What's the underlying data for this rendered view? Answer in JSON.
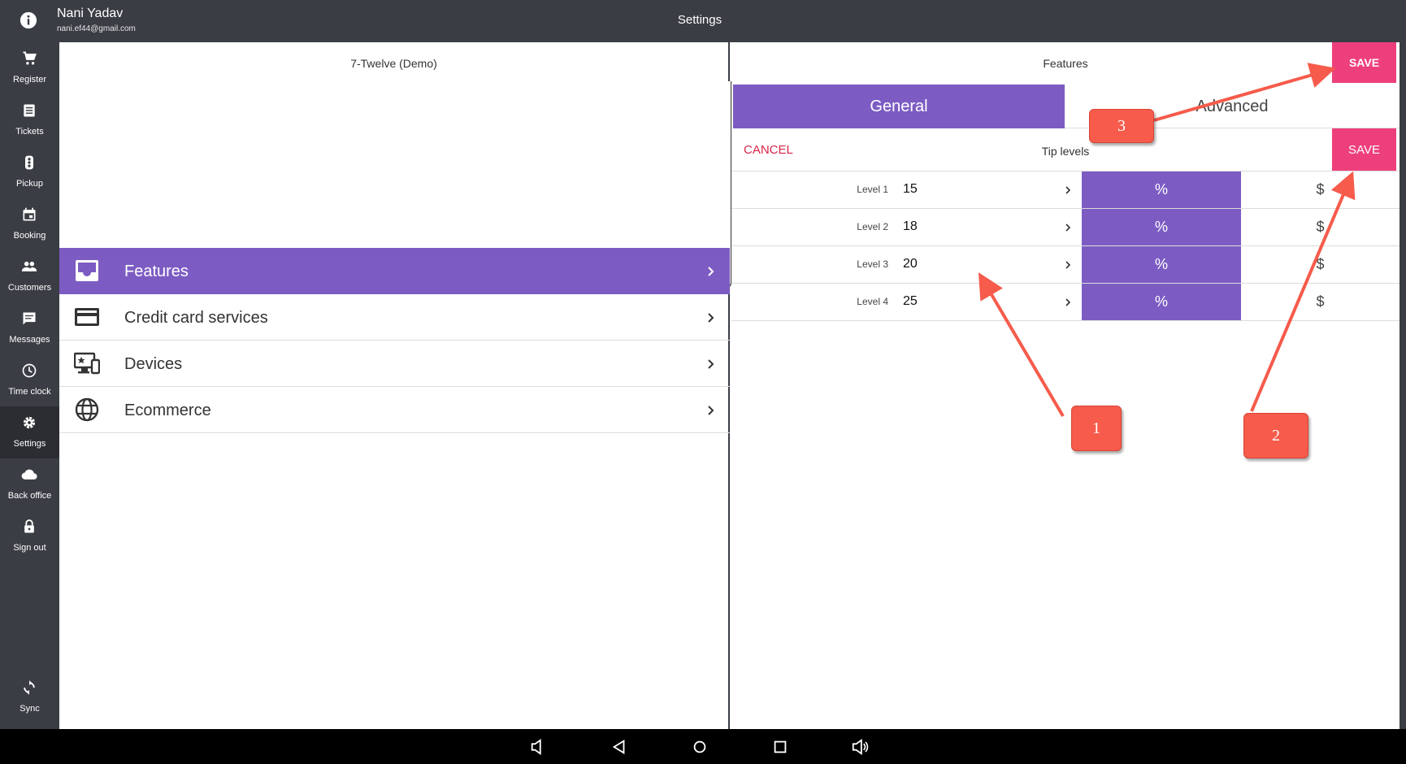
{
  "header": {
    "user_name": "Nani Yadav",
    "user_email": "nani.ef44@gmail.com",
    "page_title": "Settings"
  },
  "sidebar": {
    "items": [
      {
        "label": "Register",
        "icon": "cart-icon"
      },
      {
        "label": "Tickets",
        "icon": "tickets-icon"
      },
      {
        "label": "Pickup",
        "icon": "pickup-icon"
      },
      {
        "label": "Booking",
        "icon": "calendar-icon"
      },
      {
        "label": "Customers",
        "icon": "customers-icon"
      },
      {
        "label": "Messages",
        "icon": "message-icon"
      },
      {
        "label": "Time clock",
        "icon": "clock-icon"
      },
      {
        "label": "Settings",
        "icon": "gear-icon",
        "active": true
      },
      {
        "label": "Back office",
        "icon": "cloud-icon"
      },
      {
        "label": "Sign out",
        "icon": "lock-icon"
      }
    ],
    "sync_label": "Sync"
  },
  "left_panel": {
    "store_name": "7-Twelve (Demo)",
    "menu": [
      {
        "label": "Features",
        "icon": "features-icon",
        "active": true
      },
      {
        "label": "Credit card services",
        "icon": "credit-card-icon"
      },
      {
        "label": "Devices",
        "icon": "devices-icon"
      },
      {
        "label": "Ecommerce",
        "icon": "globe-icon"
      }
    ]
  },
  "right_panel": {
    "title": "Features",
    "save_label": "SAVE",
    "tabs": [
      {
        "label": "General",
        "active": true
      },
      {
        "label": "Advanced"
      }
    ],
    "cancel_label": "CANCEL",
    "section_title": "Tip levels",
    "section_save_label": "SAVE",
    "levels": [
      {
        "label": "Level 1",
        "value": "15",
        "percent": "%",
        "dollar": "$"
      },
      {
        "label": "Level 2",
        "value": "18",
        "percent": "%",
        "dollar": "$"
      },
      {
        "label": "Level 3",
        "value": "20",
        "percent": "%",
        "dollar": "$"
      },
      {
        "label": "Level 4",
        "value": "25",
        "percent": "%",
        "dollar": "$"
      }
    ]
  },
  "annotations": {
    "callouts": [
      "1",
      "2",
      "3"
    ]
  },
  "colors": {
    "accent": "#7c5cc3",
    "save": "#ee3f7d",
    "cancel": "#d9264a",
    "sidebar": "#3a3d44",
    "callout": "#f65b4b"
  }
}
